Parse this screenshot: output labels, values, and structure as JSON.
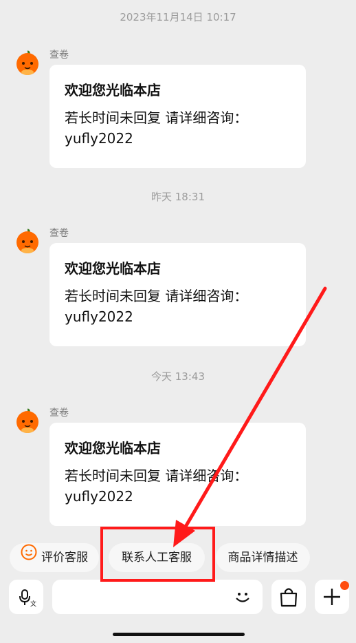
{
  "timestamps": [
    "2023年11月14日 10:17",
    "昨天  18:31",
    "今天  13:43"
  ],
  "messages": [
    {
      "sender": "查卷",
      "title": "欢迎您光临本店",
      "body": "若长时间未回复   请详细咨询：yufly2022"
    },
    {
      "sender": "查卷",
      "title": "欢迎您光临本店",
      "body": "若长时间未回复   请详细咨询：yufly2022"
    },
    {
      "sender": "查卷",
      "title": "欢迎您光临本店",
      "body": "若长时间未回复   请详细咨询：yufly2022"
    }
  ],
  "quick_actions": {
    "review": "评价客服",
    "human_agent": "联系人工客服",
    "product_details": "商品详情描述"
  },
  "input_bar": {
    "voice_icon": "voice-translate-icon",
    "emoji_icon": "emoji-icon",
    "shop_icon": "shopping-bag-icon",
    "add_icon": "plus-icon"
  },
  "colors": {
    "annotation": "#ff1a1a",
    "badge": "#ff4d0f",
    "mascot": "#ff6a00"
  }
}
